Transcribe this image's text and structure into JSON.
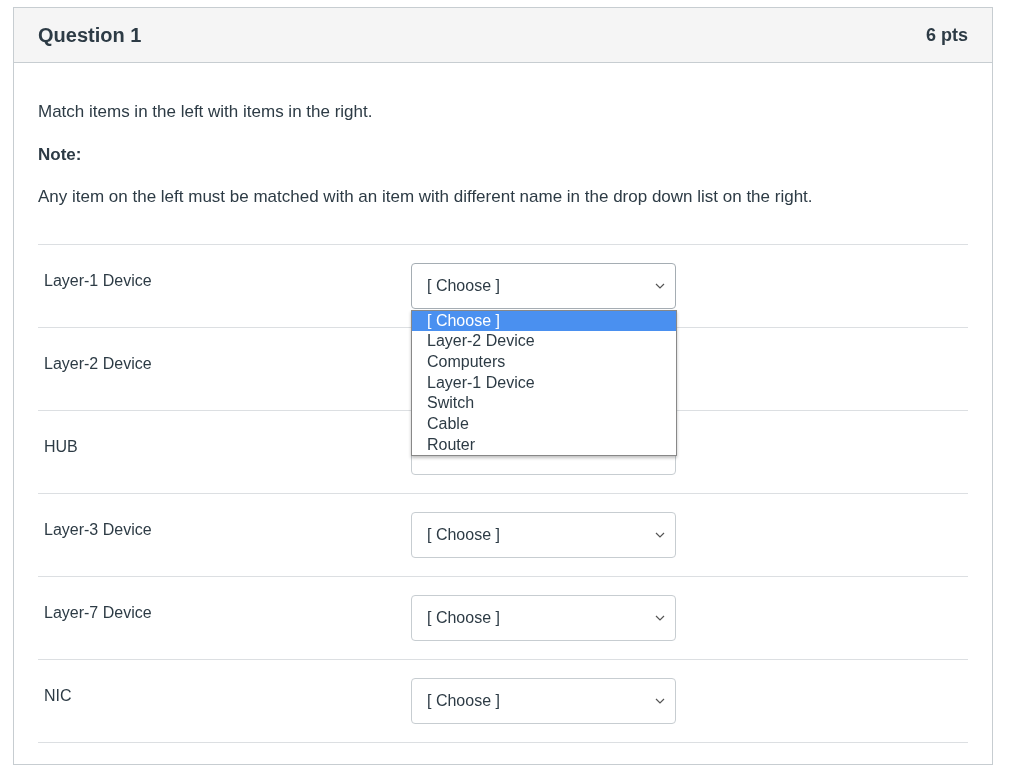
{
  "question": {
    "title": "Question 1",
    "points": "6 pts"
  },
  "instructions": [
    "Match items in the left with items in the right.",
    "Note:",
    "Any item on the left must be matched with an item with different name in the drop down list on the right."
  ],
  "rows": [
    {
      "label": "Layer-1 Device",
      "select": {
        "value": "[ Choose ]",
        "expanded": true
      }
    },
    {
      "label": "Layer-2 Device"
    },
    {
      "label": "HUB",
      "select": {
        "expanded": false
      }
    },
    {
      "label": "Layer-3 Device",
      "select": {
        "value": "[ Choose ]",
        "expanded": false
      }
    },
    {
      "label": "Layer-7 Device",
      "select": {
        "value": "[ Choose ]",
        "expanded": false
      }
    },
    {
      "label": "NIC",
      "select": {
        "value": "[ Choose ]",
        "expanded": false
      }
    }
  ],
  "dropdown_options": [
    {
      "label": "[ Choose ]",
      "selected": true
    },
    {
      "label": "Layer-2 Device",
      "selected": false
    },
    {
      "label": "Computers",
      "selected": false
    },
    {
      "label": "Layer-1 Device",
      "selected": false
    },
    {
      "label": "Switch",
      "selected": false
    },
    {
      "label": "Cable",
      "selected": false
    },
    {
      "label": "Router",
      "selected": false
    }
  ]
}
